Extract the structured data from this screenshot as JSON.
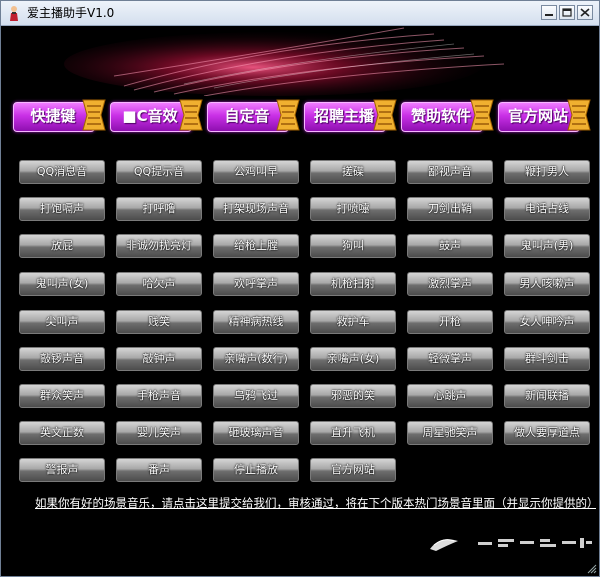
{
  "window": {
    "title": "爱主播助手V1.0"
  },
  "top_nav": [
    {
      "label": "快捷键"
    },
    {
      "label": "■C音效"
    },
    {
      "label": "自定音"
    },
    {
      "label": "招聘主播"
    },
    {
      "label": "赞助软件"
    },
    {
      "label": "官方网站"
    }
  ],
  "sound_buttons": [
    [
      "QQ消息音",
      "QQ提示音",
      "公鸡叫早",
      "搓碟",
      "鄙视声音",
      "鞭打男人"
    ],
    [
      "打饱嗝声",
      "打呼噜",
      "打架现场声音",
      "打喷嚏",
      "刀剑出鞘",
      "电话占线"
    ],
    [
      "放屁",
      "非诚勿扰亮灯",
      "给枪上膛",
      "狗叫",
      "鼓声",
      "鬼叫声(男)"
    ],
    [
      "鬼叫声(女)",
      "哈欠声",
      "欢呼掌声",
      "机枪扫射",
      "激烈掌声",
      "男人咳嗽声"
    ],
    [
      "尖叫声",
      "贱笑",
      "精神病热线",
      "救护车",
      "开枪",
      "女人呻吟声"
    ],
    [
      "敲锣声音",
      "敲钟声",
      "亲嘴声(数行)",
      "亲嘴声(女)",
      "轻微掌声",
      "群斗剑击"
    ],
    [
      "群众笑声",
      "手枪声音",
      "乌鸦飞过",
      "邪恶的笑",
      "心跳声",
      "新闻联播"
    ],
    [
      "英文正数",
      "婴儿笑声",
      "砸玻璃声音",
      "直升飞机",
      "周星驰笑声",
      "做人要厚道点"
    ],
    [
      "警报声",
      "番声",
      "停止播放",
      "官方网站"
    ]
  ],
  "footer_link": "如果你有好的场景音乐，请点击这里提交给我们，审核通过，将在下个版本热门场景音里面（并显示你提供的）",
  "colors": {
    "nav_accent": "#c930e6",
    "ribbon": "#f0b030",
    "banner_glow": "#ff2a6a"
  },
  "icons": {
    "app": "app-icon",
    "minimize": "minimize-icon",
    "maximize": "maximize-icon",
    "close": "close-icon"
  }
}
